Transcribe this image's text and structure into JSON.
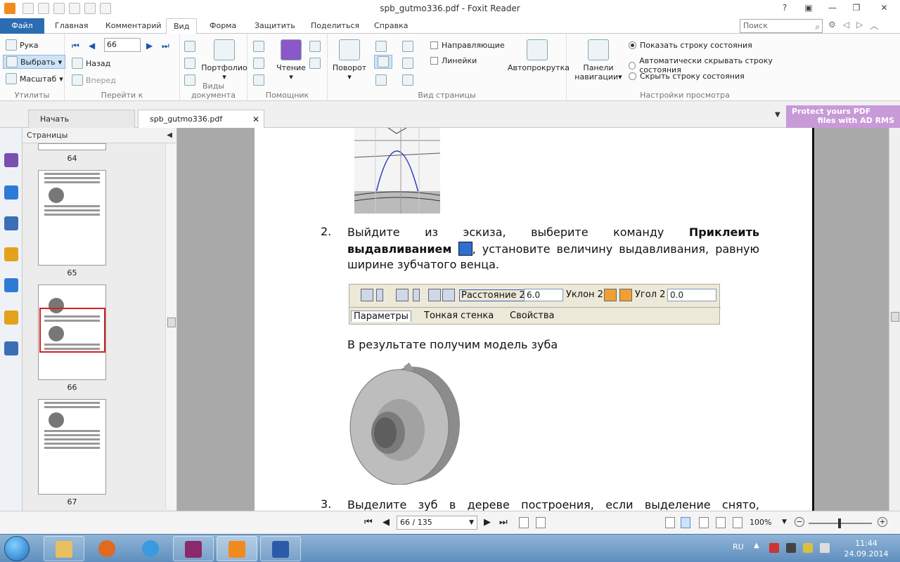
{
  "window": {
    "title": "spb_gutmo336.pdf - Foxit Reader"
  },
  "ribbon_tabs": [
    "Файл",
    "Главная",
    "Комментарий",
    "Вид",
    "Форма",
    "Защитить",
    "Поделиться",
    "Справка"
  ],
  "search": {
    "placeholder": "Поиск"
  },
  "ribbon": {
    "utilities": {
      "hand": "Рука",
      "select": "Выбрать",
      "zoom": "Масштаб",
      "label": "Утилиты"
    },
    "goto": {
      "page_value": "66",
      "back": "Назад",
      "forward": "Вперед",
      "label": "Перейти к"
    },
    "docviews": {
      "portfolio": "Портфолио",
      "label": "Виды документа"
    },
    "assistant": {
      "read": "Чтение",
      "label": "Помощник"
    },
    "pageview": {
      "rotate": "Поворот",
      "guides": "Направляющие",
      "rulers": "Линейки",
      "label": "Вид страницы"
    },
    "autoscroll": "Автопрокрутка",
    "navpanels_l1": "Панели",
    "navpanels_l2": "навигации",
    "viewsettings": {
      "opt1": "Показать строку состояния",
      "opt2": "Автоматически скрывать строку состояния",
      "opt3": "Скрыть строку состояния",
      "label": "Настройки просмотра"
    }
  },
  "doc_tabs": {
    "start": "Начать",
    "file": "spb_gutmo336.pdf"
  },
  "promo": {
    "line1": "Protect yours PDF",
    "line2": "files with AD RMS"
  },
  "pages_panel": {
    "title": "Страницы",
    "labels": [
      "64",
      "65",
      "66",
      "67"
    ]
  },
  "document": {
    "step2_num": "2.",
    "step2_line1_a": "Выйдите из эскиза, выберите команду ",
    "step2_line1_b": "Приклеить",
    "step2_line2_a": "выдавливанием",
    "step2_line2_b": ", установите величину выдавливания, равную",
    "step2_line3": "ширине зубчатого венца.",
    "toolbar": {
      "distance_label": "Расстояние 2",
      "distance_value": "6.0",
      "draft_label": "Уклон 2",
      "angle_label": "Угол 2",
      "angle_value": "0.0",
      "tab_params": "Параметры",
      "tab_thin": "Тонкая стенка",
      "tab_props": "Свойства"
    },
    "result_text": "В результате получим модель зуба",
    "step3_num": "3.",
    "step3_text": "Выделите зуб в дереве построения, если выделение снято,"
  },
  "status": {
    "page_field": "66 / 135",
    "zoom": "100%"
  },
  "taskbar": {
    "lang": "RU",
    "time": "11:44",
    "date": "24.09.2014"
  }
}
